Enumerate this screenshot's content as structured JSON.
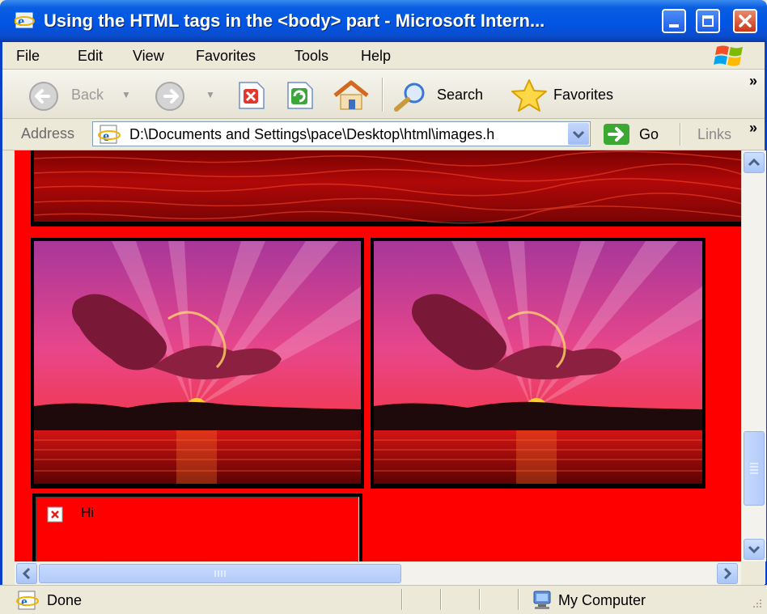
{
  "window": {
    "title": "Using the HTML tags in the <body> part - Microsoft Intern...",
    "buttons": [
      "minimize",
      "maximize",
      "close"
    ]
  },
  "menu": [
    "File",
    "Edit",
    "View",
    "Favorites",
    "Tools",
    "Help"
  ],
  "toolbar": {
    "back_label": "Back",
    "search_label": "Search",
    "favorites_label": "Favorites",
    "overflow": "»"
  },
  "address": {
    "label": "Address",
    "value": "D:\\Documents and Settings\\pace\\Desktop\\html\\images.h",
    "go_label": "Go",
    "links_label": "Links",
    "overflow": "»"
  },
  "page": {
    "background_color": "#ff0000",
    "broken_image_alt": "Hi"
  },
  "statusbar": {
    "status": "Done",
    "zone": "My Computer"
  },
  "colors": {
    "titlebar": "#0055e5",
    "chrome": "#ece9d8",
    "page_bg": "#ff0000"
  }
}
